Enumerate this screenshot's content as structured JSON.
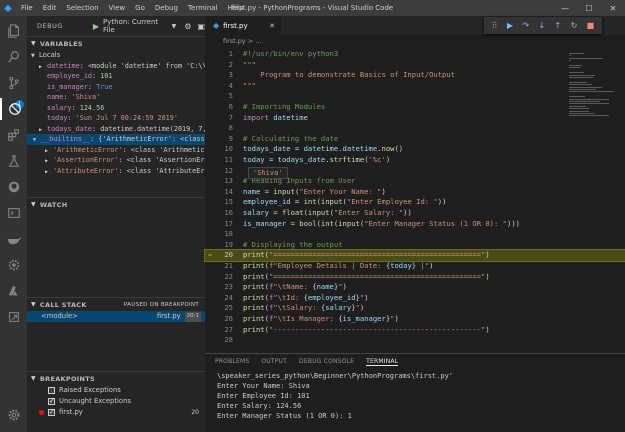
{
  "titlebar": {
    "menu": [
      "File",
      "Edit",
      "Selection",
      "View",
      "Go",
      "Debug",
      "Terminal",
      "Help"
    ],
    "title": "first.py - PythonPrograms - Visual Studio Code",
    "controls": [
      "—",
      "☐",
      "✕"
    ]
  },
  "activitybar": {
    "icons": [
      "files-icon",
      "search-icon",
      "source-control-icon",
      "debug-icon",
      "extensions-icon",
      "test-icon",
      "github-icon",
      "terminal-icon",
      "docker-icon",
      "settings-sync-icon",
      "azure-icon",
      "deploy-icon"
    ],
    "badge": "1"
  },
  "sidebar": {
    "debug_title": "DEBUG",
    "config": "Python: Current File",
    "variables_header": "VARIABLES",
    "locals_label": "Locals",
    "variables": [
      {
        "name": "datetime",
        "value": "<module 'datetime' from 'C:\\\\U…",
        "kind": "plain",
        "expandable": true
      },
      {
        "name": "employee_id",
        "value": "101",
        "kind": "num",
        "expandable": false
      },
      {
        "name": "is_manager",
        "value": "True",
        "kind": "bool",
        "expandable": false
      },
      {
        "name": "name",
        "value": "'Shiva'",
        "kind": "str",
        "expandable": false
      },
      {
        "name": "salary",
        "value": "124.56",
        "kind": "num",
        "expandable": false
      },
      {
        "name": "today",
        "value": "'Sun Jul  7 00:24:59 2019'",
        "kind": "str",
        "expandable": false
      },
      {
        "name": "todays_date",
        "value": "datetime.datetime(2019, 7, …",
        "kind": "plain",
        "expandable": true
      }
    ],
    "globals_row": {
      "name": "__builtins__",
      "value": "{'ArithmeticError': <class…"
    },
    "builtins_children": [
      {
        "name": "'ArithmeticError'",
        "value": "<class 'ArithmeticErr…"
      },
      {
        "name": "'AssertionError'",
        "value": "<class 'AssertionErro…"
      },
      {
        "name": "'AttributeError'",
        "value": "<class 'AttributeErro…"
      }
    ],
    "watch_header": "WATCH",
    "callstack_header": "CALL STACK",
    "callstack_note": "PAUSED ON BREAKPOINT",
    "callstack": [
      {
        "frame": "<module>",
        "file": "first.py",
        "line": "20:1"
      }
    ],
    "breakpoints_header": "BREAKPOINTS",
    "breakpoints": [
      {
        "label": "Raised Exceptions",
        "checked": false,
        "dot": false,
        "num": ""
      },
      {
        "label": "Uncaught Exceptions",
        "checked": true,
        "dot": false,
        "num": ""
      },
      {
        "label": "first.py",
        "checked": true,
        "dot": true,
        "num": "20"
      }
    ]
  },
  "editor": {
    "tab_label": "first.py",
    "breadcrumb": "first.py > ...",
    "debug_toolbar": [
      "⠿",
      "▶",
      "↷",
      "↓",
      "↑",
      "↻",
      "■"
    ],
    "hover_value": "'Shiva'",
    "current_line": 20,
    "lines": [
      {
        "n": "1",
        "html": "<span class='c-cmt'>#!/usr/bin/env python3</span>"
      },
      {
        "n": "2",
        "html": "<span class='c-str'>\"\"\"</span>"
      },
      {
        "n": "3",
        "html": "<span class='c-str'>    Program to demonstrate Basics of Input/Output</span>"
      },
      {
        "n": "4",
        "html": "<span class='c-str'>\"\"\"</span>"
      },
      {
        "n": "5",
        "html": ""
      },
      {
        "n": "6",
        "html": "<span class='c-cmt'># Importing Modules</span>"
      },
      {
        "n": "7",
        "html": "<span class='c-kw'>import</span> <span class='c-var'>datetime</span>"
      },
      {
        "n": "8",
        "html": ""
      },
      {
        "n": "9",
        "html": "<span class='c-cmt'># Calculating the date</span>"
      },
      {
        "n": "10",
        "html": "<span class='c-var'>todays_date</span> = <span class='c-var'>datetime</span>.<span class='c-var'>datetime</span>.<span class='c-fn'>now</span>()"
      },
      {
        "n": "11",
        "html": "<span class='c-var'>today</span> = <span class='c-var'>todays_date</span>.<span class='c-fn'>strftime</span>(<span class='c-str'>'%c'</span>)"
      },
      {
        "n": "12",
        "html": ""
      },
      {
        "n": "13",
        "html": "<span class='c-cmt'># Reading Inputs from User</span>"
      },
      {
        "n": "14",
        "html": "<span class='c-var'>name</span> = <span class='c-fn'>input</span>(<span class='c-str'>\"Enter Your Name: \"</span>)"
      },
      {
        "n": "15",
        "html": "<span class='c-var'>employee_id</span> = <span class='c-fn'>int</span>(<span class='c-fn'>input</span>(<span class='c-str'>\"Enter Employee Id: \"</span>))"
      },
      {
        "n": "16",
        "html": "<span class='c-var'>salary</span> = <span class='c-fn'>float</span>(<span class='c-fn'>input</span>(<span class='c-str'>\"Enter Salary: \"</span>))"
      },
      {
        "n": "17",
        "html": "<span class='c-var'>is_manager</span> = <span class='c-fn'>bool</span>(<span class='c-fn'>int</span>(<span class='c-fn'>input</span>(<span class='c-str'>\"Enter Manager Status (1 OR 0): \"</span>)))"
      },
      {
        "n": "18",
        "html": ""
      },
      {
        "n": "19",
        "html": "<span class='c-cmt'># Displaying the output</span>"
      },
      {
        "n": "20",
        "html": "<span class='c-fn'>print</span>(<span class='c-str'>\"================================================\"</span>)"
      },
      {
        "n": "21",
        "html": "<span class='c-fn'>print</span>(<span class='c-kw'>f</span><span class='c-str'>\"Employee Details | Date: </span>{<span class='c-var'>today</span>}<span class='c-str'> |\"</span>)"
      },
      {
        "n": "22",
        "html": "<span class='c-fn'>print</span>(<span class='c-str'>\"================================================\"</span>)"
      },
      {
        "n": "23",
        "html": "<span class='c-fn'>print</span>(<span class='c-kw'>f</span><span class='c-str'>\"\\tName: </span>{<span class='c-var'>name</span>}<span class='c-str'>\"</span>)"
      },
      {
        "n": "24",
        "html": "<span class='c-fn'>print</span>(<span class='c-kw'>f</span><span class='c-str'>\"\\tId: </span>{<span class='c-var'>employee_id</span>}<span class='c-str'>\"</span>)"
      },
      {
        "n": "25",
        "html": "<span class='c-fn'>print</span>(<span class='c-kw'>f</span><span class='c-str'>\"\\tSalary: </span>{<span class='c-var'>salary</span>}<span class='c-str'>\"</span>)"
      },
      {
        "n": "26",
        "html": "<span class='c-fn'>print</span>(<span class='c-kw'>f</span><span class='c-str'>\"\\tIs Manager: </span>{<span class='c-var'>is_manager</span>}<span class='c-str'>\"</span>)"
      },
      {
        "n": "27",
        "html": "<span class='c-fn'>print</span>(<span class='c-str'>\"------------------------------------------------\"</span>)"
      },
      {
        "n": "28",
        "html": ""
      }
    ]
  },
  "panel": {
    "tabs": [
      "PROBLEMS",
      "OUTPUT",
      "DEBUG CONSOLE",
      "TERMINAL"
    ],
    "active_tab": "TERMINAL",
    "terminal_lines": [
      "\\speaker_series_python\\Beginner\\PythonPrograms\\first.py'",
      "Enter Your Name: Shiva",
      "Enter Employee Id: 101",
      "Enter Salary: 124.56",
      "Enter Manager Status (1 OR 0): 1"
    ]
  }
}
